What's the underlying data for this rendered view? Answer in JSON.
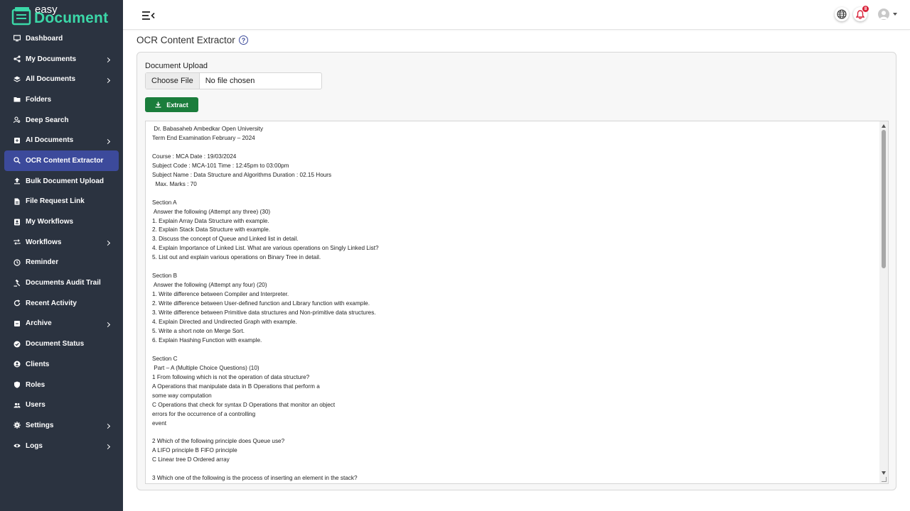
{
  "brand": {
    "small": "easy",
    "big": "Document",
    "accent": "#3bd8a8"
  },
  "sidebar": {
    "background": "#2b3340",
    "active_color": "#3c4a9b",
    "items": [
      {
        "label": "Dashboard",
        "icon": "monitor-icon",
        "has_children": false
      },
      {
        "label": "My Documents",
        "icon": "share-icon",
        "has_children": true
      },
      {
        "label": "All Documents",
        "icon": "layers-icon",
        "has_children": true
      },
      {
        "label": "Folders",
        "icon": "folder-icon",
        "has_children": false
      },
      {
        "label": "Deep Search",
        "icon": "person-search-icon",
        "has_children": false
      },
      {
        "label": "AI Documents",
        "icon": "ai-document-icon",
        "has_children": true
      },
      {
        "label": "OCR Content Extractor",
        "icon": "search-icon",
        "has_children": false,
        "active": true
      },
      {
        "label": "Bulk Document Upload",
        "icon": "upload-icon",
        "has_children": false
      },
      {
        "label": "File Request Link",
        "icon": "file-icon",
        "has_children": false
      },
      {
        "label": "My Workflows",
        "icon": "workflow-icon",
        "has_children": false
      },
      {
        "label": "Workflows",
        "icon": "repeat-icon",
        "has_children": true
      },
      {
        "label": "Reminder",
        "icon": "clock-icon",
        "has_children": false
      },
      {
        "label": "Documents Audit Trail",
        "icon": "gavel-icon",
        "has_children": false
      },
      {
        "label": "Recent Activity",
        "icon": "refresh-icon",
        "has_children": false
      },
      {
        "label": "Archive",
        "icon": "archive-icon",
        "has_children": true
      },
      {
        "label": "Document Status",
        "icon": "check-circle-icon",
        "has_children": false
      },
      {
        "label": "Clients",
        "icon": "user-circle-icon",
        "has_children": false
      },
      {
        "label": "Roles",
        "icon": "shield-icon",
        "has_children": false
      },
      {
        "label": "Users",
        "icon": "users-icon",
        "has_children": false
      },
      {
        "label": "Settings",
        "icon": "gear-icon",
        "has_children": true
      },
      {
        "label": "Logs",
        "icon": "eye-icon",
        "has_children": true
      }
    ]
  },
  "topbar": {
    "menu_icon": "menu-collapse-icon",
    "language_icon": "globe-icon",
    "notifications_icon": "bell-icon",
    "notification_count": "8",
    "avatar_icon": "user-avatar-icon"
  },
  "page": {
    "title": "OCR Content Extractor",
    "help_icon": "question-circle-icon",
    "upload_label": "Document Upload",
    "file_button": "Choose File",
    "file_status": "No file chosen",
    "extract_label": "Extract",
    "extract_color": "#1b7d3c"
  },
  "extracted_text": [
    " Dr. Babasaheb Ambedkar Open University",
    "Term End Examination February – 2024",
    "",
    "Course : MCA Date : 19/03/2024",
    "Subject Code : MCA-101 Time : 12:45pm to 03:00pm",
    "Subject Name : Data Structure and Algorithms Duration : 02.15 Hours",
    "  Max. Marks : 70",
    "",
    "Section A",
    " Answer the following (Attempt any three) (30)",
    "1. Explain Array Data Structure with example.",
    "2. Explain Stack Data Structure with example.",
    "3. Discuss the concept of Queue and Linked list in detail.",
    "4. Explain Importance of Linked List. What are various operations on Singly Linked List?",
    "5. List out and explain various operations on Binary Tree in detail.",
    "",
    "Section B",
    " Answer the following (Attempt any four) (20)",
    "1. Write difference between Compiler and Interpreter.",
    "2. Write difference between User-defined function and Library function with example.",
    "3. Write difference between Primitive data structures and Non-primitive data structures.",
    "4. Explain Directed and Undirected Graph with example.",
    "5. Write a short note on Merge Sort.",
    "6. Explain Hashing Function with example.",
    "",
    "Section C",
    " Part – A (Multiple Choice Questions) (10)",
    "1 From following which is not the operation of data structure?",
    "A Operations that manipulate data in B Operations that perform a",
    "some way computation",
    "C Operations that check for syntax D Operations that monitor an object",
    "errors for the occurrence of a controlling",
    "event",
    "",
    "2 Which of the following principle does Queue use?",
    "A LIFO principle B FIFO principle",
    "C Linear tree D Ordered array",
    "",
    "3 Which one of the following is the process of inserting an element in the stack?"
  ]
}
